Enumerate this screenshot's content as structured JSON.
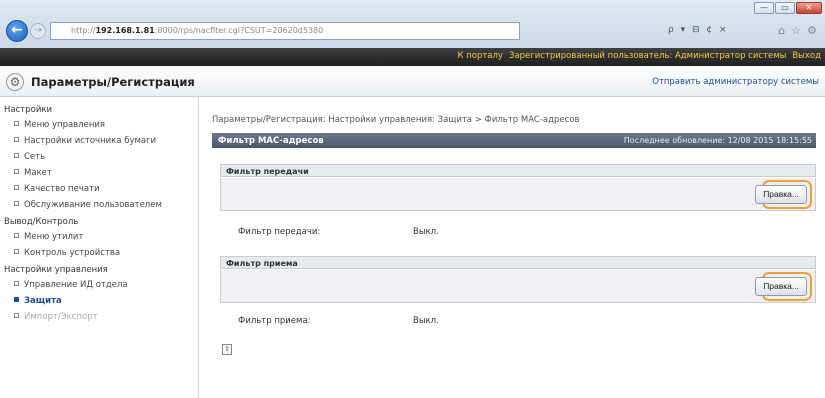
{
  "browser": {
    "url_prefix": "http://",
    "url_host": "192.168.1.81",
    "url_rest": ":8000/rps/nacflter.cgi?CSUT=20620d5380",
    "search_tools": "ρ ▾ ⊟ ¢ ×",
    "window_buttons": [
      "—",
      "▭",
      "✕"
    ]
  },
  "topbar": {
    "portal_link": "К порталу",
    "user_text": "Зарегистрированный пользователь: Администратор системы",
    "logout_link": "Выход"
  },
  "header": {
    "title": "Параметры/Регистрация",
    "send_admin_link": "Отправить администратору системы"
  },
  "sidebar": {
    "groups": [
      {
        "label": "Настройки",
        "items": [
          {
            "label": "Меню управления"
          },
          {
            "label": "Настройки источника бумаги"
          },
          {
            "label": "Сеть"
          },
          {
            "label": "Макет"
          },
          {
            "label": "Качество печати"
          },
          {
            "label": "Обслуживание пользователем"
          }
        ]
      },
      {
        "label": "Вывод/Контроль",
        "items": [
          {
            "label": "Меню утилит"
          },
          {
            "label": "Контроль устройства"
          }
        ]
      },
      {
        "label": "Настройки управления",
        "items": [
          {
            "label": "Управление ИД отдела"
          },
          {
            "label": "Защита"
          },
          {
            "label": "Импорт/Экспорт"
          }
        ]
      }
    ]
  },
  "main": {
    "breadcrumb": "Параметры/Регистрация: Настройки управления: Защита > Фильтр MAC-адресов",
    "panel_title": "Фильтр MAC-адресов",
    "last_update": "Последнее обновление: 12/08 2015 18:15:55",
    "sections": [
      {
        "title": "Фильтр передачи",
        "edit_label": "Правка...",
        "row_label": "Фильтр передачи:",
        "row_value": "Выкл."
      },
      {
        "title": "Фильтр приема",
        "edit_label": "Правка...",
        "row_label": "Фильтр приема:",
        "row_value": "Выкл."
      }
    ]
  },
  "colors": {
    "highlight_ring": "#f0a030",
    "topbar_link": "#f2c84b",
    "link": "#1a4f9f"
  }
}
